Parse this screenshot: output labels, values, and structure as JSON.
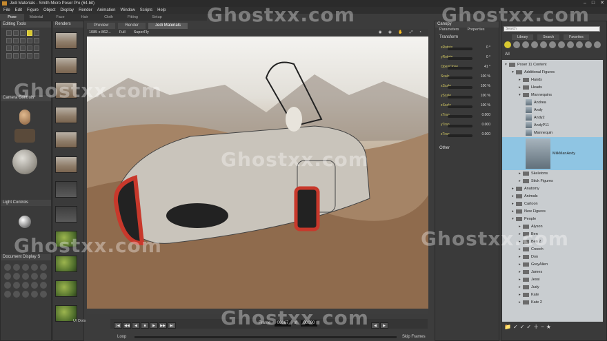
{
  "window": {
    "title": "Jedi Materials - Smith Micro Poser Pro (64-bit)",
    "minimize": "–",
    "maximize": "□",
    "close": "✕"
  },
  "menu": [
    "File",
    "Edit",
    "Figure",
    "Object",
    "Display",
    "Render",
    "Animation",
    "Window",
    "Scripts",
    "Help"
  ],
  "rooms": [
    {
      "label": "Pose",
      "active": true
    },
    {
      "label": "Material"
    },
    {
      "label": "Face"
    },
    {
      "label": "Hair"
    },
    {
      "label": "Cloth"
    },
    {
      "label": "Fitting"
    },
    {
      "label": "Setup"
    }
  ],
  "left_panels": {
    "editing_tools": "Editing Tools",
    "camera_controls": "Camera Controls",
    "light_controls": "Light Controls",
    "document_display": "Document Display S",
    "ui_dots": "UI Dots"
  },
  "renders": {
    "title": "Renders"
  },
  "view_tabs": [
    {
      "label": "Preview"
    },
    {
      "label": "Render"
    },
    {
      "label": "Jedi Materials",
      "active": true
    }
  ],
  "view_toolbar": {
    "size": "1085 x 862...",
    "mode": "Full",
    "renderer": "SuperFly"
  },
  "params": {
    "panel_title": "Canopy",
    "tabs": [
      "Parameters",
      "Properties"
    ],
    "group": "Transform",
    "other": "Other",
    "rows": [
      {
        "name": "xRotate",
        "value": "0 °"
      },
      {
        "name": "yRotate",
        "value": "0 °"
      },
      {
        "name": "OpenClose",
        "value": "41 °"
      },
      {
        "name": "Scale",
        "value": "100 %"
      },
      {
        "name": "xScale",
        "value": "100 %"
      },
      {
        "name": "yScale",
        "value": "100 %"
      },
      {
        "name": "zScale",
        "value": "100 %"
      },
      {
        "name": "xTran",
        "value": "0.000"
      },
      {
        "name": "yTran",
        "value": "0.000"
      },
      {
        "name": "zTran",
        "value": "0.000"
      }
    ]
  },
  "library": {
    "search_placeholder": "Search",
    "tabs": [
      "Library",
      "Search",
      "Favorites"
    ],
    "all_label": "All",
    "rows": [
      {
        "label": "Poser 11 Content",
        "indent": 0,
        "type": "folder",
        "open": true
      },
      {
        "label": "Additional Figures",
        "indent": 1,
        "type": "folder",
        "open": true
      },
      {
        "label": "Hands",
        "indent": 2,
        "type": "folder"
      },
      {
        "label": "Heads",
        "indent": 2,
        "type": "folder"
      },
      {
        "label": "Mannequins",
        "indent": 2,
        "type": "folder",
        "open": true
      },
      {
        "label": "Andrea",
        "indent": 3,
        "type": "fig"
      },
      {
        "label": "Andy",
        "indent": 3,
        "type": "fig"
      },
      {
        "label": "Andy2",
        "indent": 3,
        "type": "fig"
      },
      {
        "label": "AndyP11",
        "indent": 3,
        "type": "fig"
      },
      {
        "label": "Mannequin",
        "indent": 3,
        "type": "fig"
      },
      {
        "label": "MilkManAndy",
        "indent": 3,
        "type": "big",
        "selected": true
      },
      {
        "label": "Skeletons",
        "indent": 2,
        "type": "folder"
      },
      {
        "label": "Stick Figures",
        "indent": 2,
        "type": "folder"
      },
      {
        "label": "Anatomy",
        "indent": 1,
        "type": "folder"
      },
      {
        "label": "Animals",
        "indent": 1,
        "type": "folder"
      },
      {
        "label": "Cartoon",
        "indent": 1,
        "type": "folder"
      },
      {
        "label": "New Figures",
        "indent": 1,
        "type": "folder"
      },
      {
        "label": "People",
        "indent": 1,
        "type": "folder",
        "open": true
      },
      {
        "label": "Alyson",
        "indent": 2,
        "type": "folder"
      },
      {
        "label": "Ben",
        "indent": 2,
        "type": "folder"
      },
      {
        "label": "Ben 2",
        "indent": 2,
        "type": "folder"
      },
      {
        "label": "Creech",
        "indent": 2,
        "type": "folder"
      },
      {
        "label": "Don",
        "indent": 2,
        "type": "folder"
      },
      {
        "label": "GreyAlien",
        "indent": 2,
        "type": "folder"
      },
      {
        "label": "James",
        "indent": 2,
        "type": "folder"
      },
      {
        "label": "Jessi",
        "indent": 2,
        "type": "folder"
      },
      {
        "label": "Judy",
        "indent": 2,
        "type": "folder"
      },
      {
        "label": "Kate",
        "indent": 2,
        "type": "folder"
      },
      {
        "label": "Kate 2",
        "indent": 2,
        "type": "folder"
      }
    ]
  },
  "timeline": {
    "frame_label": "Frame",
    "frame": "00067",
    "of_label": "of",
    "total": "00090",
    "loop": "Loop",
    "skip": "Skip Frames"
  },
  "watermark": "Ghostxx.com"
}
